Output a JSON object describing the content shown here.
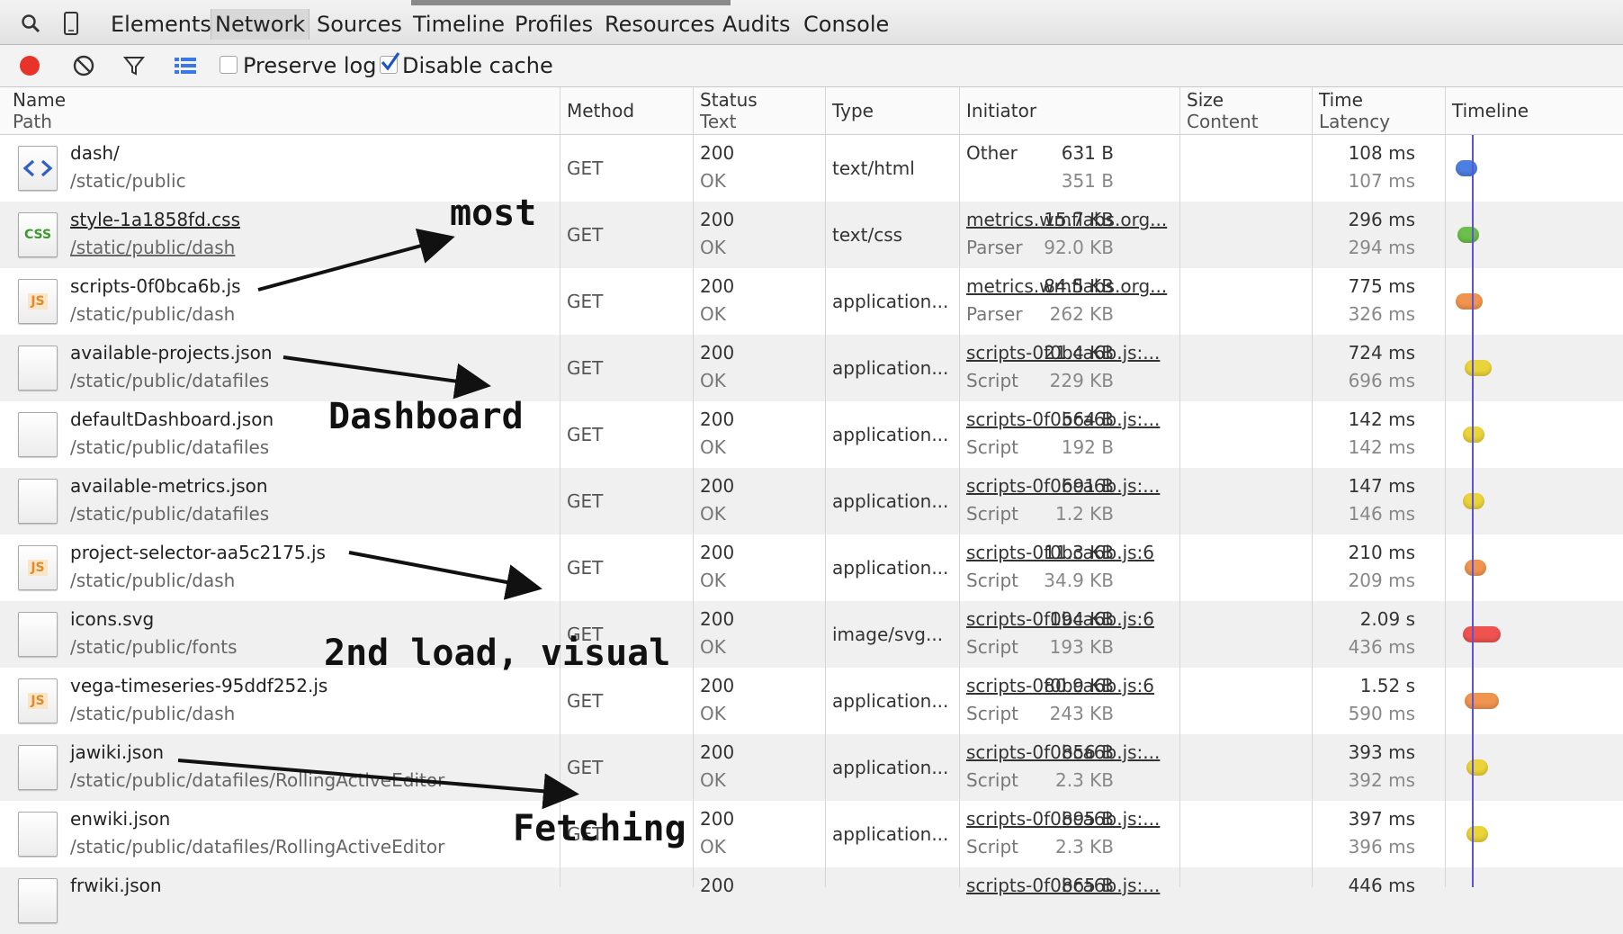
{
  "tabs": [
    {
      "label": "Elements",
      "selected": false
    },
    {
      "label": "Network",
      "selected": true
    },
    {
      "label": "Sources",
      "selected": false
    },
    {
      "label": "Timeline",
      "selected": false
    },
    {
      "label": "Profiles",
      "selected": false
    },
    {
      "label": "Resources",
      "selected": false
    },
    {
      "label": "Audits",
      "selected": false
    },
    {
      "label": "Console",
      "selected": false
    }
  ],
  "toolbar": {
    "preserve_log_label": "Preserve log",
    "preserve_log_checked": false,
    "disable_cache_label": "Disable cache",
    "disable_cache_checked": true,
    "record_color": "#e8332b"
  },
  "columns": {
    "name": "Name",
    "path": "Path",
    "method": "Method",
    "status": "Status",
    "text": "Text",
    "type": "Type",
    "initiator": "Initiator",
    "size": "Size",
    "content": "Content",
    "time": "Time",
    "latency": "Latency",
    "timeline": "Timeline"
  },
  "rows": [
    {
      "icon": "html-file-icon",
      "name": "dash/",
      "path": "/static/public",
      "method": "GET",
      "status": "200",
      "status_text": "OK",
      "type": "text/html",
      "initiator": "Other",
      "initiator_sub": "",
      "initiator_link": false,
      "size": "631 B",
      "content": "351 B",
      "time": "108 ms",
      "latency": "107 ms",
      "color": "#4d7fe0"
    },
    {
      "icon": "css-file-icon",
      "name": "style-1a1858fd.css",
      "path": "/static/public/dash",
      "method": "GET",
      "status": "200",
      "status_text": "OK",
      "type": "text/css",
      "initiator": "metrics.wmflabs.org...",
      "initiator_sub": "Parser",
      "initiator_link": true,
      "size": "15.7 KB",
      "content": "92.0 KB",
      "time": "296 ms",
      "latency": "294 ms",
      "color": "#6cbf4a"
    },
    {
      "icon": "js-file-icon",
      "name": "scripts-0f0bca6b.js",
      "path": "/static/public/dash",
      "method": "GET",
      "status": "200",
      "status_text": "OK",
      "type": "application...",
      "initiator": "metrics.wmflabs.org...",
      "initiator_sub": "Parser",
      "initiator_link": true,
      "size": "84.5 KB",
      "content": "262 KB",
      "time": "775 ms",
      "latency": "326 ms",
      "color": "#f0944f"
    },
    {
      "icon": "blank-file-icon",
      "name": "available-projects.json",
      "path": "/static/public/datafiles",
      "method": "GET",
      "status": "200",
      "status_text": "OK",
      "type": "application...",
      "initiator": "scripts-0f0bca6b.js:...",
      "initiator_sub": "Script",
      "initiator_link": true,
      "size": "21.4 KB",
      "content": "229 KB",
      "time": "724 ms",
      "latency": "696 ms",
      "color": "#ebd33a"
    },
    {
      "icon": "blank-file-icon",
      "name": "defaultDashboard.json",
      "path": "/static/public/datafiles",
      "method": "GET",
      "status": "200",
      "status_text": "OK",
      "type": "application...",
      "initiator": "scripts-0f0bca6b.js:...",
      "initiator_sub": "Script",
      "initiator_link": true,
      "size": "564 B",
      "content": "192 B",
      "time": "142 ms",
      "latency": "142 ms",
      "color": "#ebd33a"
    },
    {
      "icon": "blank-file-icon",
      "name": "available-metrics.json",
      "path": "/static/public/datafiles",
      "method": "GET",
      "status": "200",
      "status_text": "OK",
      "type": "application...",
      "initiator": "scripts-0f0bca6b.js:...",
      "initiator_sub": "Script",
      "initiator_link": true,
      "size": "691 B",
      "content": "1.2 KB",
      "time": "147 ms",
      "latency": "146 ms",
      "color": "#ebd33a"
    },
    {
      "icon": "js-file-icon",
      "name": "project-selector-aa5c2175.js",
      "path": "/static/public/dash",
      "method": "GET",
      "status": "200",
      "status_text": "OK",
      "type": "application...",
      "initiator": "scripts-0f0bca6b.js:6",
      "initiator_sub": "Script",
      "initiator_link": true,
      "size": "11.3 KB",
      "content": "34.9 KB",
      "time": "210 ms",
      "latency": "209 ms",
      "color": "#f0944f"
    },
    {
      "icon": "blank-file-icon",
      "name": "icons.svg",
      "path": "/static/public/fonts",
      "method": "GET",
      "status": "200",
      "status_text": "OK",
      "type": "image/svg...",
      "initiator": "scripts-0f0bca6b.js:6",
      "initiator_sub": "Script",
      "initiator_link": true,
      "size": "194 KB",
      "content": "193 KB",
      "time": "2.09 s",
      "latency": "436 ms",
      "color": "#ef5350"
    },
    {
      "icon": "js-file-icon",
      "name": "vega-timeseries-95ddf252.js",
      "path": "/static/public/dash",
      "method": "GET",
      "status": "200",
      "status_text": "OK",
      "type": "application...",
      "initiator": "scripts-0f0bca6b.js:6",
      "initiator_sub": "Script",
      "initiator_link": true,
      "size": "80.9 KB",
      "content": "243 KB",
      "time": "1.52 s",
      "latency": "590 ms",
      "color": "#f0944f"
    },
    {
      "icon": "blank-file-icon",
      "name": "jawiki.json",
      "path": "/static/public/datafiles/RollingActiveEditor",
      "method": "GET",
      "status": "200",
      "status_text": "OK",
      "type": "application...",
      "initiator": "scripts-0f0bca6b.js:...",
      "initiator_sub": "Script",
      "initiator_link": true,
      "size": "856 B",
      "content": "2.3 KB",
      "time": "393 ms",
      "latency": "392 ms",
      "color": "#ebd33a"
    },
    {
      "icon": "blank-file-icon",
      "name": "enwiki.json",
      "path": "/static/public/datafiles/RollingActiveEditor",
      "method": "GET",
      "status": "200",
      "status_text": "OK",
      "type": "application...",
      "initiator": "scripts-0f0bca6b.js:...",
      "initiator_sub": "Script",
      "initiator_link": true,
      "size": "895 B",
      "content": "2.3 KB",
      "time": "397 ms",
      "latency": "396 ms",
      "color": "#ebd33a"
    },
    {
      "icon": "blank-file-icon",
      "name": "frwiki.json",
      "path": "",
      "method": "",
      "status": "200",
      "status_text": "",
      "type": "",
      "initiator": "scripts-0f0bca6b.js:...",
      "initiator_sub": "",
      "initiator_link": true,
      "size": "865 B",
      "content": "",
      "time": "446 ms",
      "latency": "",
      "color": ""
    }
  ],
  "annotations": {
    "most": "most",
    "dashboard": "Dashboard",
    "second_load": "2nd load, visual",
    "fetching": "Fetching"
  }
}
